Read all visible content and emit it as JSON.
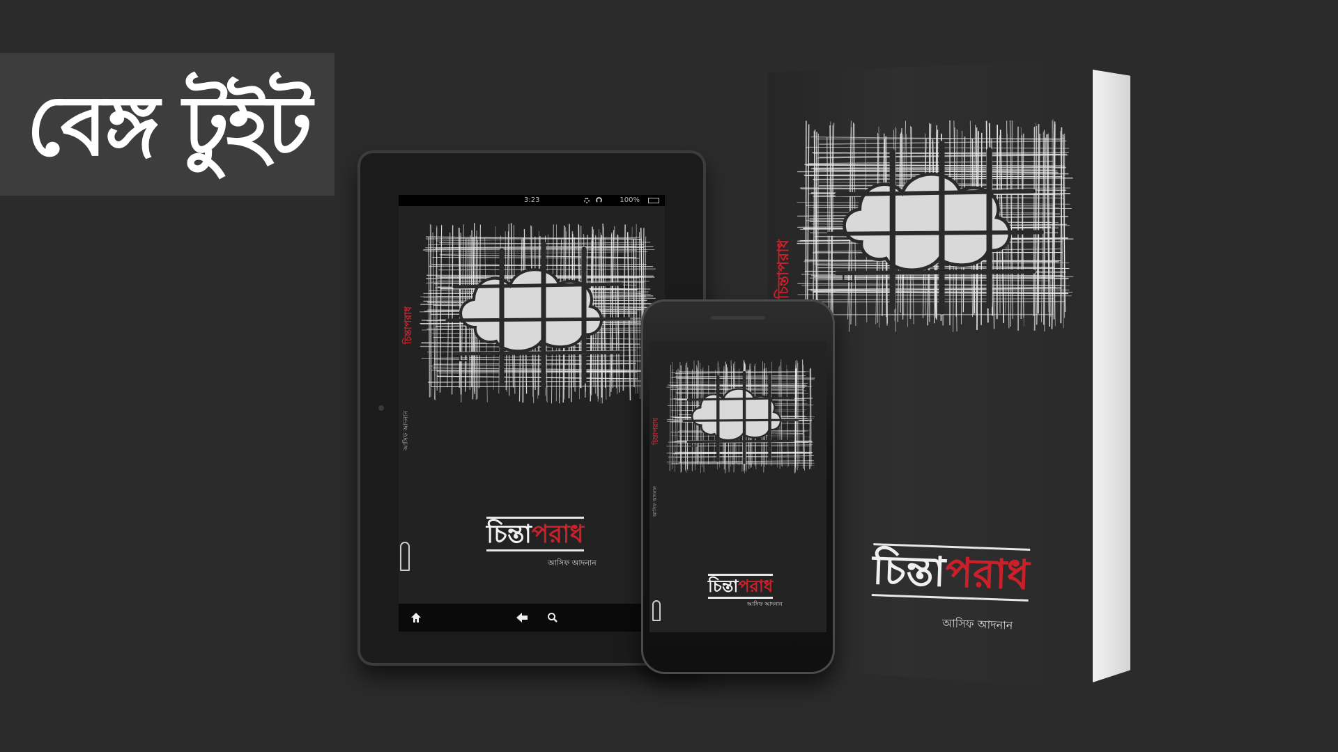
{
  "brand": {
    "logo_text": "বেঙ্গ টুইট"
  },
  "book": {
    "title_part1": "চিন্তা",
    "title_part2": "পরাধ",
    "author": "আসিফ আদনান",
    "accent_color": "#c9202a"
  },
  "tablet": {
    "status_time": "3:23",
    "status_battery": "100%",
    "nav_home_icon": "home-icon",
    "nav_back_icon": "back-arrow-icon",
    "nav_search_icon": "search-icon"
  },
  "colors": {
    "background": "#2b2b2b",
    "logo_box": "#3d3d3d"
  }
}
